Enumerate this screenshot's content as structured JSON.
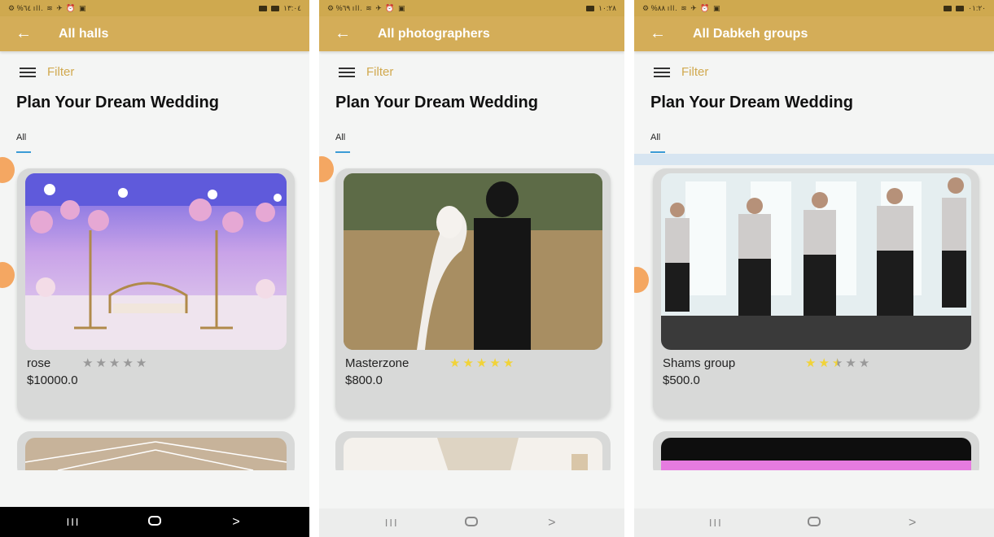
{
  "screens": [
    {
      "status": {
        "left": "⚙ %٦٤ ıll. ≋ ✈ ⏰ ▣",
        "right": "١٣:٠٤"
      },
      "appbar_title": "All halls",
      "filter_label": "Filter",
      "heading": "Plan Your Dream Wedding",
      "tab_label": "All",
      "card": {
        "name": "rose",
        "price": "$10000.0",
        "rating": 0
      },
      "navbar": "dark"
    },
    {
      "status": {
        "left": "⚙ %٦٩ ıll. ≋ ✈ ⏰ ▣",
        "right": "١٠:٢٨"
      },
      "appbar_title": "All photographers",
      "filter_label": "Filter",
      "heading": "Plan Your Dream Wedding",
      "tab_label": "All",
      "card": {
        "name": "Masterzone",
        "price": "$800.0",
        "rating": 5
      },
      "navbar": "light"
    },
    {
      "status": {
        "left": "⚙ %٨٨ ıll. ≋ ✈ ⏰ ▣",
        "right": "٠١:٢٠"
      },
      "appbar_title": "All Dabkeh groups",
      "filter_label": "Filter",
      "heading": "Plan Your Dream Wedding",
      "tab_label": "All",
      "card": {
        "name": "Shams group",
        "price": "$500.0",
        "rating": 2.5
      },
      "navbar": "light"
    }
  ],
  "nav": {
    "recents": "III",
    "home": "",
    "back": ">"
  },
  "icons": {
    "back": "arrow-left-icon",
    "menu": "hamburger-menu-icon",
    "star": "star-icon"
  },
  "colors": {
    "appbar": "#d4ad58",
    "filter": "#d1a94f",
    "star_on": "#f1d338",
    "star_off": "#999999",
    "tab_indicator": "#3b9bd6"
  }
}
